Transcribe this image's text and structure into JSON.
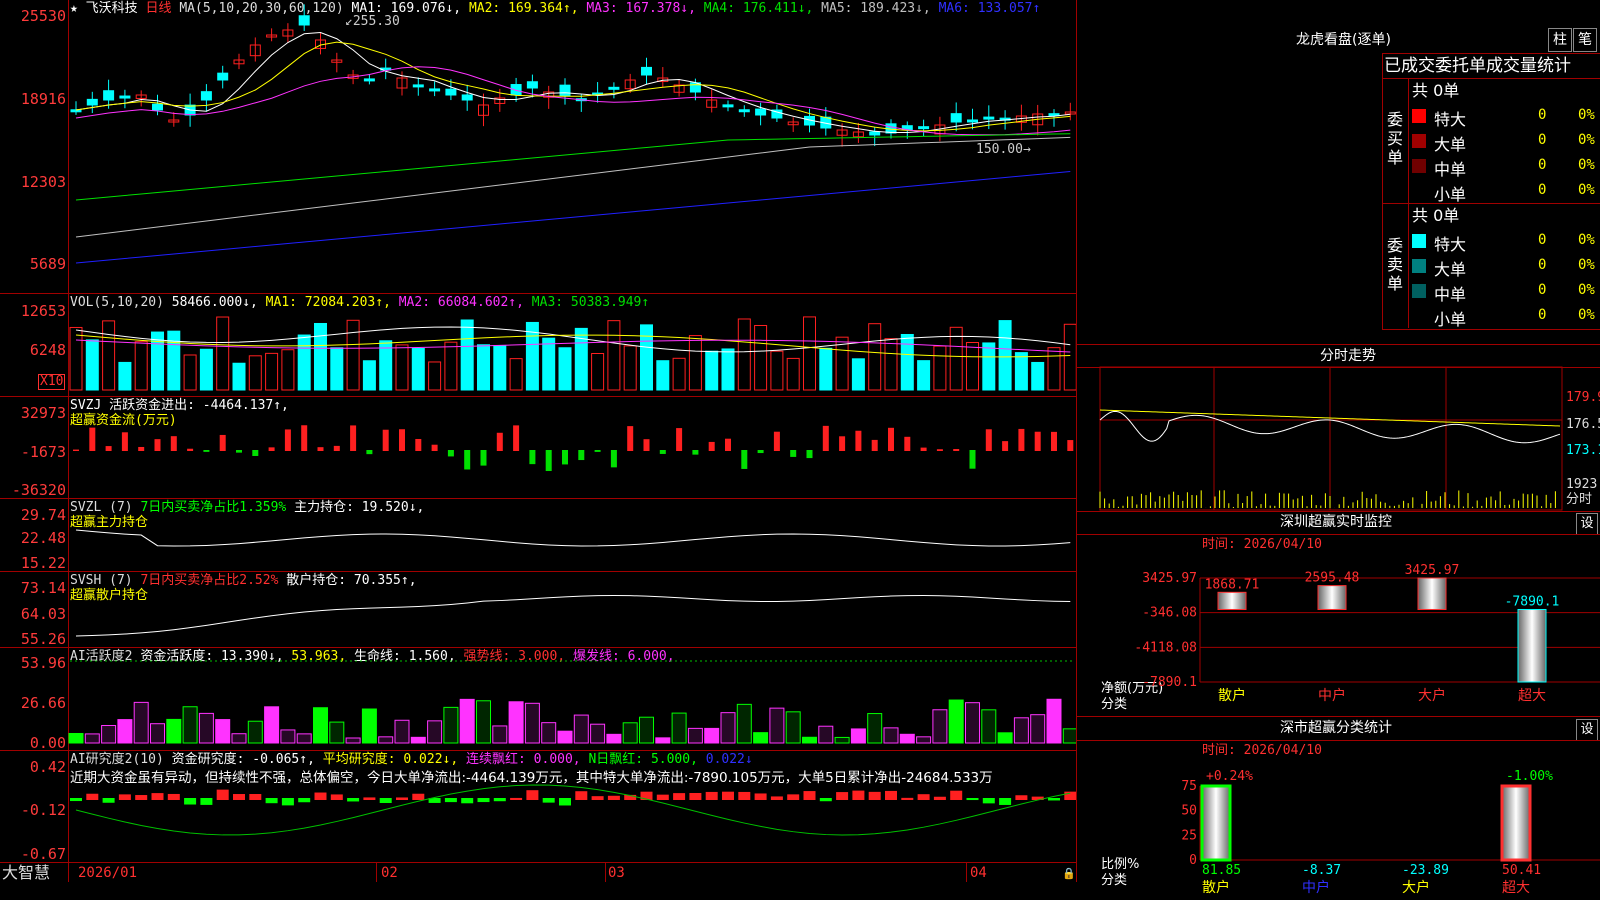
{
  "colors": {
    "up": "#ff2020",
    "down": "#00ffff",
    "ma1": "#ffffff",
    "ma2": "#ffff00",
    "ma3": "#ff33ff",
    "ma4": "#00e000",
    "ma5": "#c0c0c0",
    "ma6": "#2020ff",
    "grid": "#a00000"
  },
  "main": {
    "title": "飞沃科技",
    "period": "日线",
    "ma_label": "MA(5,10,20,30,60,120)",
    "ma1": "MA1: 169.076↓,",
    "ma2": "MA2: 169.364↑,",
    "ma3": "MA3: 167.378↓,",
    "ma4": "MA4: 176.411↓,",
    "ma5": "MA5: 189.423↓,",
    "ma6": "MA6: 133.057↑",
    "y_ticks": [
      "25530",
      "18916",
      "12303",
      "5689"
    ],
    "high_marker": "255.30",
    "low_marker": "150.00"
  },
  "vol": {
    "label": "VOL(5,10,20)",
    "value": "58466.000↓,",
    "ma1": "MA1: 72084.203↑,",
    "ma2": "MA2: 66084.602↑,",
    "ma3": "MA3: 50383.949↑",
    "y_ticks": [
      "12653",
      "6248"
    ],
    "unit": "X10"
  },
  "svzj": {
    "line1": "SVZJ  活跃资金进出: -4464.137↑,",
    "line2": "超赢资金流(万元)",
    "y_ticks": [
      "32973",
      "-1673",
      "-36320"
    ]
  },
  "svzl": {
    "label": "SVZL (7)",
    "ratio": "7日内买卖净占比1.359%",
    "hold": "主力持仓: 19.520↓,",
    "line2": "超赢主力持仓",
    "y_ticks": [
      "29.74",
      "22.48",
      "15.22"
    ]
  },
  "svsh": {
    "label": "SVSH (7)",
    "ratio": "7日内买卖净占比2.52%",
    "hold": "散户持仓: 70.355↑,",
    "line2": "超赢散户持仓",
    "y_ticks": [
      "73.14",
      "64.03",
      "55.26"
    ]
  },
  "ai1": {
    "label": "AI活跃度2",
    "v1": "资金活跃度: 13.390↓,",
    "v2": "53.963,",
    "v3": "生命线: 1.560,",
    "v4": "强势线: 3.000,",
    "v5": "爆发线: 6.000,",
    "y_ticks": [
      "53.96",
      "26.66",
      "0.00"
    ]
  },
  "ai2": {
    "label": "AI研究度2(10)",
    "v1": "资金研究度: -0.065↑,",
    "v2": "平均研究度: 0.022↓,",
    "v3": "连续飘红: 0.000,",
    "v4": "N日飘红: 5.000,",
    "v5": "0.022↓",
    "comment": "近期大资金虽有异动，但持续性不强，总体偏空，今日大单净流出:-4464.139万元，其中特大单净流出:-7890.105万元，大单5日累计净出-24684.533万",
    "y_ticks": [
      "0.42",
      "-0.12",
      "-0.67"
    ]
  },
  "xaxis": {
    "brand": "大智慧",
    "labels": [
      "2026/01",
      "02",
      "03",
      "04"
    ]
  },
  "right": {
    "lhb": {
      "title": "龙虎看盘(逐单)",
      "btn1": "柱",
      "btn2": "笔",
      "tabs": "已成交委托单成交量统计",
      "buy": {
        "side": "委买单",
        "total": "共 0单",
        "rows": [
          {
            "name": "特大",
            "n": "0",
            "p": "0%",
            "c": "#ff0000"
          },
          {
            "name": "大单",
            "n": "0",
            "p": "0%",
            "c": "#a00000"
          },
          {
            "name": "中单",
            "n": "0",
            "p": "0%",
            "c": "#700000"
          },
          {
            "name": "小单",
            "n": "0",
            "p": "0%",
            "c": "#000000"
          }
        ]
      },
      "sell": {
        "side": "委卖单",
        "total": "共 0单",
        "rows": [
          {
            "name": "特大",
            "n": "0",
            "p": "0%",
            "c": "#00ffff"
          },
          {
            "name": "大单",
            "n": "0",
            "p": "0%",
            "c": "#008080"
          },
          {
            "name": "中单",
            "n": "0",
            "p": "0%",
            "c": "#006060"
          },
          {
            "name": "小单",
            "n": "0",
            "p": "0%",
            "c": "#000000"
          }
        ]
      }
    },
    "fenshi": {
      "title": "分时走势",
      "y_ticks": [
        "179.9",
        "176.5",
        "173.1"
      ],
      "vol_tick": "1923",
      "vol_label": "分时"
    },
    "sz_monitor": {
      "title": "深圳超赢实时监控",
      "btn": "设",
      "date": "时间: 2026/04/10",
      "y_ticks": [
        "3425.97",
        "-346.08",
        "-4118.08",
        "-7890.1"
      ],
      "y_label": "净额(万元)",
      "x_label": "分类",
      "bars": [
        {
          "cat": "散户",
          "value": 1868.71,
          "label": "1868.71"
        },
        {
          "cat": "中户",
          "value": 2595.48,
          "label": "2595.48"
        },
        {
          "cat": "大户",
          "value": 3425.97,
          "label": "3425.97"
        },
        {
          "cat": "超大",
          "value": -7890.1,
          "label": "-7890.1"
        }
      ]
    },
    "sz_class": {
      "title": "深市超赢分类统计",
      "btn": "设",
      "date": "时间: 2026/04/10",
      "y_ticks": [
        "75",
        "50",
        "25",
        "0"
      ],
      "y_label": "比例%",
      "x_label": "分类",
      "bars": [
        {
          "cat": "散户",
          "value": 81.85,
          "label": "81.85",
          "top": "+0.24%"
        },
        {
          "cat": "中户",
          "value": -8.37,
          "label": "-8.37"
        },
        {
          "cat": "大户",
          "value": -23.89,
          "label": "-23.89"
        },
        {
          "cat": "超大",
          "value": 50.41,
          "label": "50.41",
          "top": "-1.00%"
        }
      ]
    }
  }
}
